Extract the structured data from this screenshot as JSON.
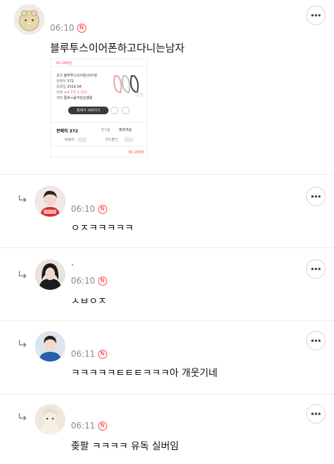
{
  "comments": [
    {
      "time": "06:10",
      "text": "블루투스이어폰하고다니는남자",
      "product": {
        "price_top": "65,280원",
        "rows": [
          {
            "k": "종류",
            "v": "블루투스이어폰/이어셋"
          },
          {
            "k": "판매처",
            "v": "372"
          },
          {
            "k": "등록일",
            "v": "2016.04."
          },
          {
            "k": "리뷰",
            "v": "★4.7/5 2,223"
          },
          {
            "k": "계정",
            "v": "통화+음악감상겸용"
          }
        ],
        "button_label": "최저가 사러가기",
        "sellers_label": "판매처 372",
        "sort_a": "인기순",
        "sort_b": "최저가순",
        "filter_a": "배송비",
        "filter_b": "카드할인",
        "bottom_price": "65,280원"
      }
    },
    {
      "nickname": "",
      "time": "06:10",
      "text": "ㅇㅈㅋㅋㅋㅋㅋ"
    },
    {
      "nickname": "ˋ",
      "time": "06:10",
      "text": "ㅅㅂㅇㅈ"
    },
    {
      "nickname": "",
      "time": "06:11",
      "text": "ㅋㅋㅋㅋㅋㅌㅌㅌㅋㅋㅋ아 개웃기네"
    },
    {
      "nickname": "",
      "time": "06:11",
      "text": "좆팔 ㅋㅋㅋㅋ 유독 실버임"
    }
  ],
  "colors": {
    "accent_red": "#ff4b4b",
    "time_gray": "#8a8a8a"
  },
  "icons": {
    "more": "more-horizontal-icon",
    "reply": "reply-arrow-icon",
    "naver": "n-badge-icon"
  }
}
